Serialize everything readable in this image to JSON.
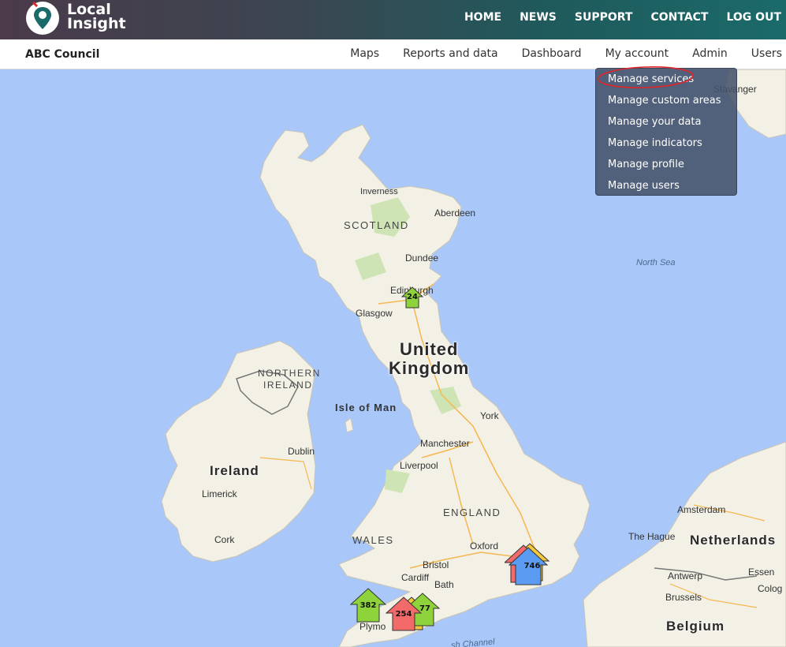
{
  "header": {
    "logo_line1": "Local",
    "logo_line2": "Insight",
    "nav": [
      "HOME",
      "NEWS",
      "SUPPORT",
      "CONTACT",
      "LOG OUT"
    ]
  },
  "subbar": {
    "council": "ABC Council",
    "nav": [
      "Maps",
      "Reports and data",
      "Dashboard",
      "My account",
      "Admin",
      "Users"
    ]
  },
  "dropdown": {
    "items": [
      "Manage services",
      "Manage custom areas",
      "Manage your data",
      "Manage indicators",
      "Manage profile",
      "Manage users"
    ]
  },
  "map": {
    "labels": {
      "stavanger": "Stavanger",
      "inverness": "Inverness",
      "aberdeen": "Aberdeen",
      "scotland": "SCOTLAND",
      "dundee": "Dundee",
      "north_sea": "North Sea",
      "edinburgh": "Edinburgh",
      "glasgow": "Glasgow",
      "united": "United",
      "kingdom": "Kingdom",
      "northern": "NORTHERN",
      "ireland_region": "IRELAND",
      "isle_of_man": "Isle of Man",
      "york": "York",
      "dublin": "Dublin",
      "ireland": "Ireland",
      "manchester": "Manchester",
      "liverpool": "Liverpool",
      "limerick": "Limerick",
      "england": "ENGLAND",
      "amsterdam": "Amsterdam",
      "cork": "Cork",
      "the_hague": "The Hague",
      "netherlands": "Netherlands",
      "wales": "WALES",
      "oxford": "Oxford",
      "bristol": "Bristol",
      "cardiff": "Cardiff",
      "bath": "Bath",
      "antwerp": "Antwerp",
      "essen": "Essen",
      "brussels": "Brussels",
      "cologne": "Colog",
      "belgium": "Belgium",
      "plymouth": "Plymo",
      "channel": "sh Channel"
    },
    "markers": [
      {
        "count": "24",
        "color": "#8ed33b"
      },
      {
        "count": "746",
        "color": "#5b9cf2"
      },
      {
        "count": "382",
        "color": "#8ed33b"
      },
      {
        "count": "254",
        "color": "#f26a6a"
      },
      {
        "count": "77",
        "color": "#8ed33b"
      }
    ]
  },
  "colors": {
    "sea": "#a9c8f9",
    "land": "#f3f0e6",
    "green_marker": "#8ed33b",
    "red_marker": "#f26a6a",
    "blue_marker": "#5b9cf2",
    "highlight": "#e0242a"
  }
}
